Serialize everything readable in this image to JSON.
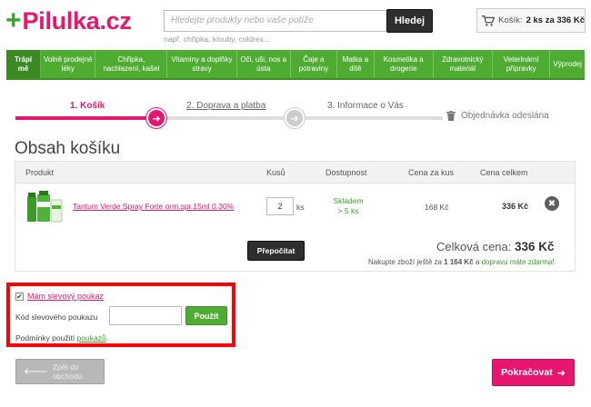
{
  "header": {
    "logo_plus": "+",
    "logo_text": "Pilulka.cz",
    "search_placeholder": "Hledejte produkty nebo vaše potíže",
    "search_button": "Hledej",
    "search_hint": "např. chřipka, klouby, coldrex...",
    "cart_label": "Košík:",
    "cart_value": "2 ks za 336 Kč"
  },
  "nav": [
    "Trápí mě",
    "Volně prodejné léky",
    "Chřipka, nachlazení, kašel",
    "Vitaminy a doplňky stravy",
    "Oči, uši, nos a ústa",
    "Čaje a potraviny",
    "Matka a dítě",
    "Kosmetika a drogerie",
    "Zdravotnický materiál",
    "Veterinární přípravky",
    "Výprodej"
  ],
  "steps": {
    "step1": "1. Košík",
    "step2": "2. Doprava a platba",
    "step3": "3. Informace o Vás",
    "step4": "Objednávka odeslána",
    "active_glyph": "➜",
    "inactive_glyph": "➜"
  },
  "cart": {
    "title": "Obsah košíku",
    "columns": {
      "product": "Produkt",
      "qty": "Kusů",
      "availability": "Dostupnost",
      "unit_price": "Cena za kus",
      "total": "Cena celkem"
    },
    "item": {
      "name": "Tantum Verde Spray Forte orm.spr.15ml 0.30%",
      "qty": "2",
      "qty_unit": "ks",
      "availability_line1": "Skladem",
      "availability_line2": "> 5 ks",
      "unit_price": "168 Kč",
      "total": "336 Kč",
      "remove": "✖"
    },
    "recalc_button": "Přepočítat",
    "sum_label": "Celková cena:",
    "sum_value": "336 Kč",
    "shipping_prefix": "Nakupte zboží ještě za",
    "shipping_amount": "1 164 Kč",
    "shipping_mid": "a",
    "shipping_green": "dopravu máte zdarma!"
  },
  "voucher": {
    "checkbox_mark": "✔",
    "link": "Mám slevový poukaz",
    "label": "Kód slevového poukazu",
    "input_value": "",
    "button": "Použít",
    "terms_prefix": "Podmínky použití",
    "terms_link": "poukazů",
    "terms_suffix": "."
  },
  "footer": {
    "back_arrow": "🡐",
    "back_label": "Zpět do obchodu",
    "continue_label": "Pokračovat",
    "continue_arrow": "➜"
  },
  "colors": {
    "brand_pink": "#e7166f",
    "brand_green": "#4fac32",
    "highlight_red": "#ff0000"
  }
}
